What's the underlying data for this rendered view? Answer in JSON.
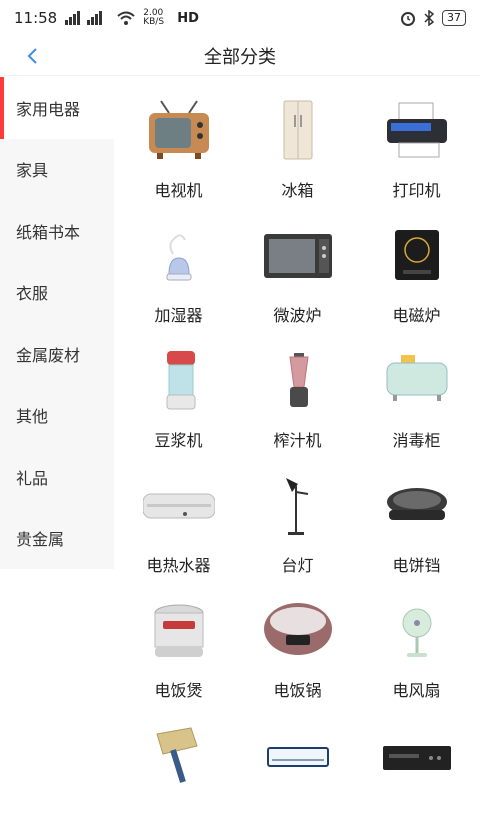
{
  "status": {
    "time": "11:58",
    "network_speed": "2.00 KB/S",
    "hd_label": "HD",
    "battery": "37"
  },
  "header": {
    "title": "全部分类"
  },
  "sidebar": {
    "items": [
      {
        "label": "家用电器"
      },
      {
        "label": "家具"
      },
      {
        "label": "纸箱书本"
      },
      {
        "label": "衣服"
      },
      {
        "label": "金属废材"
      },
      {
        "label": "其他"
      },
      {
        "label": "礼品"
      },
      {
        "label": "贵金属"
      }
    ]
  },
  "grid": {
    "items": [
      {
        "label": "电视机",
        "icon": "tv-icon"
      },
      {
        "label": "冰箱",
        "icon": "fridge-icon"
      },
      {
        "label": "打印机",
        "icon": "printer-icon"
      },
      {
        "label": "加湿器",
        "icon": "humidifier-icon"
      },
      {
        "label": "微波炉",
        "icon": "microwave-icon"
      },
      {
        "label": "电磁炉",
        "icon": "induction-cooker-icon"
      },
      {
        "label": "豆浆机",
        "icon": "soymilk-maker-icon"
      },
      {
        "label": "榨汁机",
        "icon": "juicer-icon"
      },
      {
        "label": "消毒柜",
        "icon": "sterilizer-icon"
      },
      {
        "label": "电热水器",
        "icon": "water-heater-icon"
      },
      {
        "label": "台灯",
        "icon": "desk-lamp-icon"
      },
      {
        "label": "电饼铛",
        "icon": "electric-griddle-icon"
      },
      {
        "label": "电饭煲",
        "icon": "rice-cooker-icon"
      },
      {
        "label": "电饭锅",
        "icon": "rice-pot-icon"
      },
      {
        "label": "电风扇",
        "icon": "fan-icon"
      },
      {
        "label": "",
        "icon": "hair-dryer-icon"
      },
      {
        "label": "",
        "icon": "air-conditioner-icon"
      },
      {
        "label": "",
        "icon": "dvd-player-icon"
      }
    ]
  },
  "colors": {
    "accent": "#ff3b3b",
    "sidebar_bg": "#f7f7f7",
    "back_arrow": "#3a8ee6"
  }
}
